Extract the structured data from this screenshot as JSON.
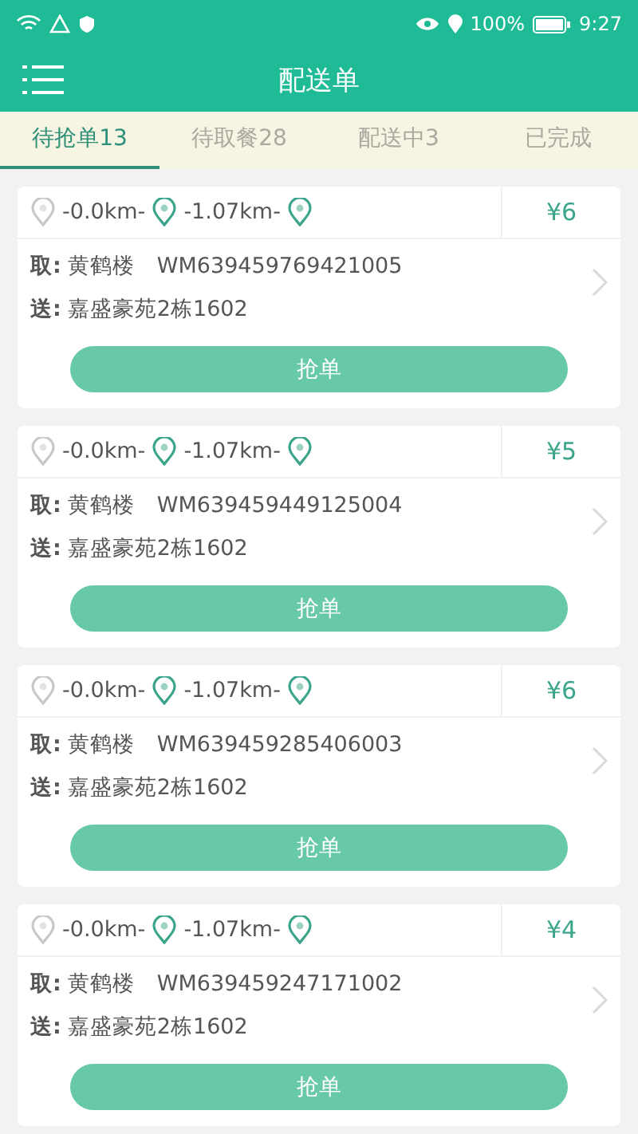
{
  "status_bar": {
    "battery": "100%",
    "time": "9:27"
  },
  "header": {
    "title": "配送单"
  },
  "tabs": [
    {
      "label": "待抢单13",
      "selected": true
    },
    {
      "label": "待取餐28",
      "selected": false
    },
    {
      "label": "配送中3",
      "selected": false
    },
    {
      "label": "已完成",
      "selected": false
    }
  ],
  "orders": [
    {
      "distance_1": "-0.0km-",
      "distance_2": "-1.07km-",
      "price": "¥6",
      "pickup_label": "取:",
      "pickup_place": "黄鹤楼",
      "order_no": "WM639459769421005",
      "deliver_label": "送:",
      "deliver_address": "嘉盛豪苑2栋1602",
      "button": "抢单"
    },
    {
      "distance_1": "-0.0km-",
      "distance_2": "-1.07km-",
      "price": "¥5",
      "pickup_label": "取:",
      "pickup_place": "黄鹤楼",
      "order_no": "WM639459449125004",
      "deliver_label": "送:",
      "deliver_address": "嘉盛豪苑2栋1602",
      "button": "抢单"
    },
    {
      "distance_1": "-0.0km-",
      "distance_2": "-1.07km-",
      "price": "¥6",
      "pickup_label": "取:",
      "pickup_place": "黄鹤楼",
      "order_no": "WM639459285406003",
      "deliver_label": "送:",
      "deliver_address": "嘉盛豪苑2栋1602",
      "button": "抢单"
    },
    {
      "distance_1": "-0.0km-",
      "distance_2": "-1.07km-",
      "price": "¥4",
      "pickup_label": "取:",
      "pickup_place": "黄鹤楼",
      "order_no": "WM639459247171002",
      "deliver_label": "送:",
      "deliver_address": "嘉盛豪苑2栋1602",
      "button": "抢单"
    }
  ]
}
